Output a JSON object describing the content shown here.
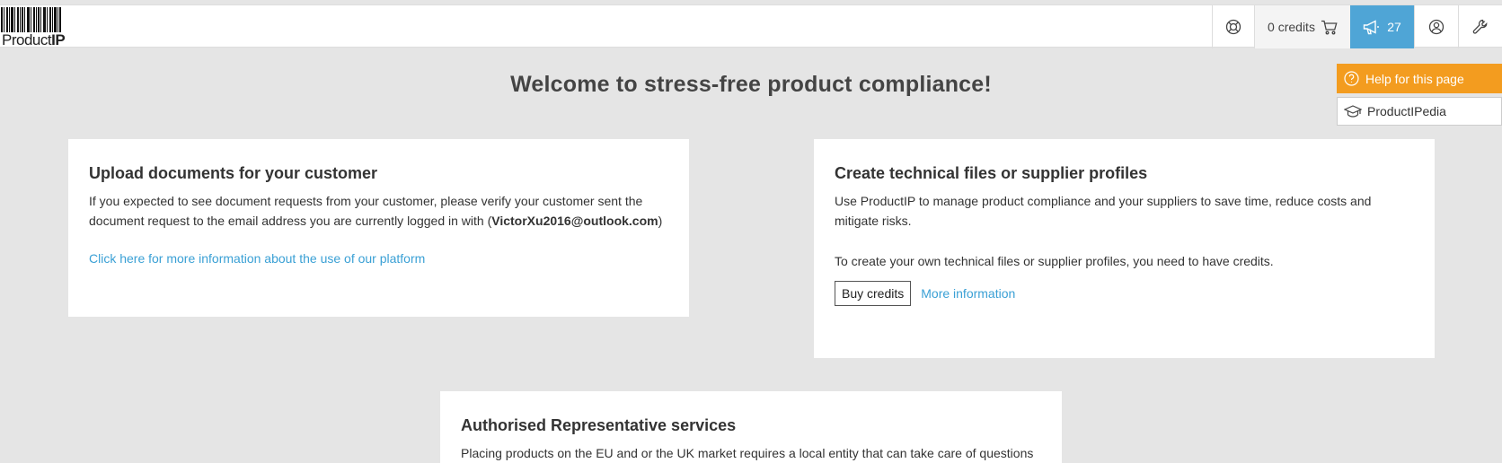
{
  "brand": {
    "logo_text_light": "Product",
    "logo_text_bold": "IP"
  },
  "nav": {
    "credits_label": "0 credits",
    "news_count": "27",
    "icons": [
      "lifebuoy-icon",
      "cart-icon",
      "megaphone-icon",
      "user-circle-icon",
      "wrench-icon"
    ]
  },
  "title": "Welcome to stress-free product compliance!",
  "help": {
    "help_label": "Help for this page",
    "wiki_label": "ProductIPedia",
    "help_color": "#f39c1f"
  },
  "cards": {
    "upload": {
      "heading": "Upload documents for your customer",
      "text_before": "If you expected to see document requests from your customer, please verify your customer sent the document request to the email address you are currently logged in with (",
      "email": "VictorXu2016@outlook.com",
      "text_after": ")",
      "link": "Click here for more information about the use of our platform"
    },
    "create": {
      "heading": "Create technical files or supplier profiles",
      "text1": "Use ProductIP to manage product compliance and your suppliers to save time, reduce costs and mitigate risks.",
      "text2": "To create your own technical files or supplier profiles, you need to have credits.",
      "buy_label": "Buy credits",
      "more_label": "More information"
    },
    "ar": {
      "heading": "Authorised Representative services",
      "text": "Placing products on the EU and or the UK market requires a local entity that can take care of questions"
    }
  },
  "colors": {
    "accent_blue": "#4fa5d6",
    "link_blue": "#3aa0d5",
    "background": "#e5e5e5"
  }
}
